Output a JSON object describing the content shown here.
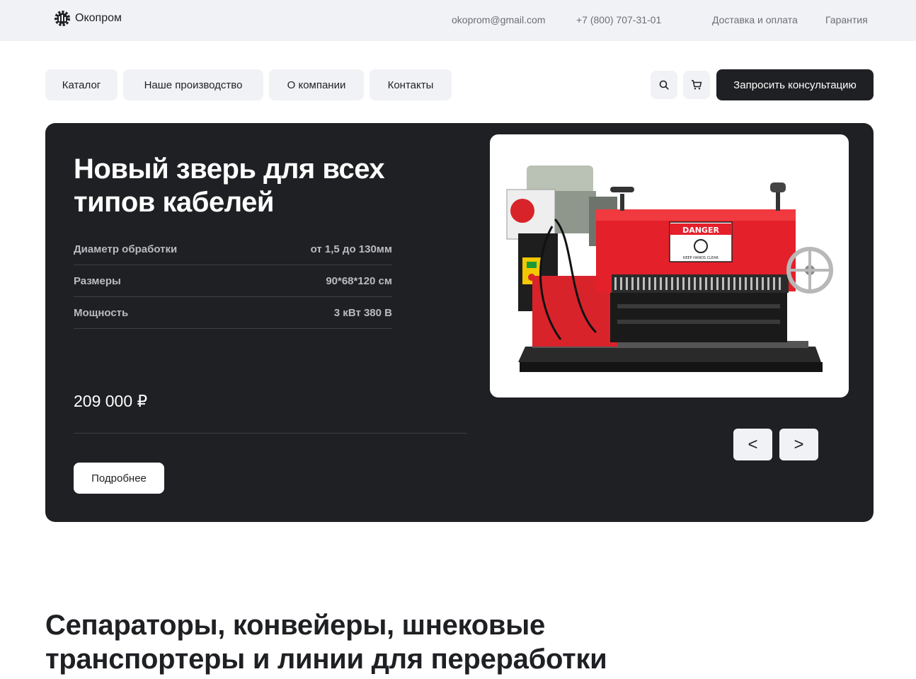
{
  "header": {
    "brand": "Окопром",
    "email": "okoprom@gmail.com",
    "phone": "+7 (800) 707-31-01",
    "links": [
      "Доставка и оплата",
      "Гарантия"
    ]
  },
  "nav": {
    "items": [
      "Каталог",
      "Наше производство",
      "О компании",
      "Контакты"
    ],
    "search_icon": "search-icon",
    "cart_icon": "cart-icon",
    "cta_label": "Запросить консультацию"
  },
  "hero": {
    "title": "Новый зверь для всех типов кабелей",
    "specs": [
      {
        "label": "Диаметр обработки",
        "value": "от 1,5 до 130мм"
      },
      {
        "label": "Размеры",
        "value": "90*68*120 см"
      },
      {
        "label": "Мощность",
        "value": "3 кВт 380 В"
      }
    ],
    "price": "209 000 ₽",
    "more_label": "Подробнее",
    "prev_label": "<",
    "next_label": ">",
    "machine_label": "DANGER",
    "machine_sublabel": "KEEP HANDS CLEAR"
  },
  "section": {
    "title": "Сепараторы, конвейеры, шнековые транспортеры и линии для переработки"
  },
  "colors": {
    "dark": "#1f2023",
    "light_bg": "#f1f2f5",
    "muted": "#6b6e75",
    "machine_red": "#e4202b"
  }
}
